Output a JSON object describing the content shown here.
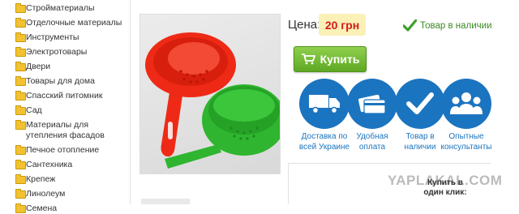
{
  "sidebar": {
    "items": [
      {
        "label": "Стройматериалы"
      },
      {
        "label": "Отделочные материалы"
      },
      {
        "label": "Инструменты"
      },
      {
        "label": "Электротовары"
      },
      {
        "label": "Двери"
      },
      {
        "label": "Товары для дома"
      },
      {
        "label": "Спасский питомник"
      },
      {
        "label": "Сад"
      },
      {
        "label": "Материалы для утепления фасадов"
      },
      {
        "label": "Печное отопление"
      },
      {
        "label": "Сантехника"
      },
      {
        "label": "Крепеж"
      },
      {
        "label": "Линолеум"
      },
      {
        "label": "Семена"
      }
    ]
  },
  "product": {
    "price_label": "Цена:",
    "price": "20 грн",
    "stock": "Товар в наличии",
    "buy_label": "Купить"
  },
  "features": [
    {
      "label": "Доставка по всей Украине",
      "icon": "truck-icon"
    },
    {
      "label": "Удобная оплата",
      "icon": "card-icon"
    },
    {
      "label": "Товар в наличии",
      "icon": "checkmark-icon"
    },
    {
      "label": "Опытные консультанты",
      "icon": "team-icon"
    }
  ],
  "one_click": "Купить в один клик:",
  "watermark": "YAPLAKAL.COM",
  "colors": {
    "accent_blue": "#1b74bf",
    "buy_green": "#6bb52b",
    "price_red": "#d51b1b",
    "price_bg": "#fbf1b6",
    "stock_green": "#3a8a24",
    "folder_yellow": "#f2c230"
  }
}
